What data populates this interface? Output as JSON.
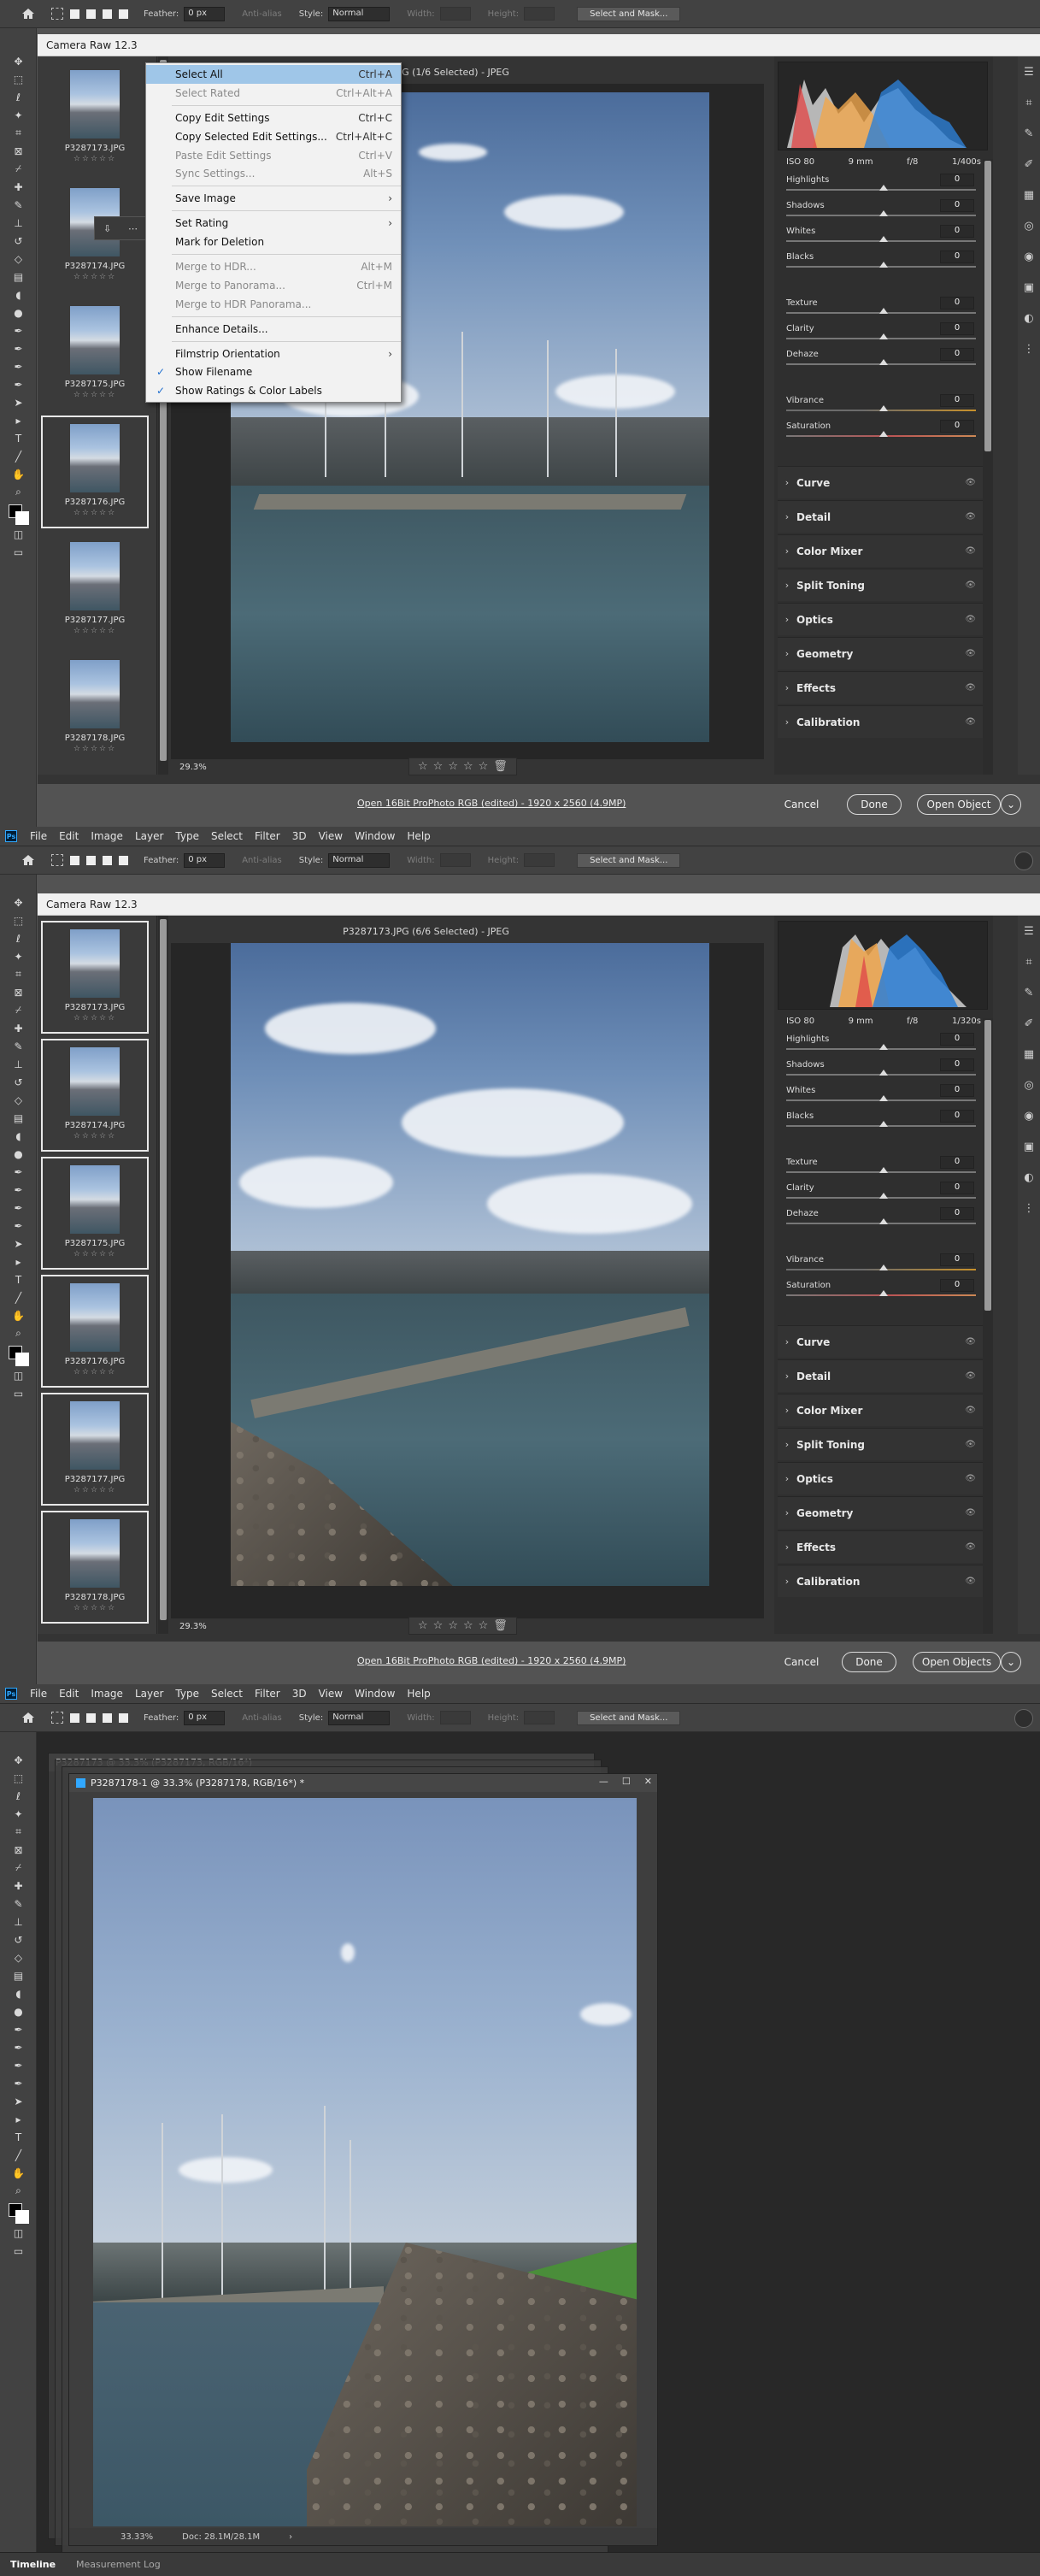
{
  "menubar": {
    "items": [
      "File",
      "Edit",
      "Image",
      "Layer",
      "Type",
      "Select",
      "Filter",
      "3D",
      "View",
      "Window",
      "Help"
    ]
  },
  "options": {
    "feather_label": "Feather:",
    "feather_value": "0 px",
    "antialias": "Anti-alias",
    "style_label": "Style:",
    "style_value": "Normal",
    "width_label": "Width:",
    "height_label": "Height:",
    "select_mask": "Select and Mask..."
  },
  "screen1": {
    "title": "Camera Raw 12.3",
    "file_caption": "P3287176.JPG (1/6 Selected)  -  JPEG",
    "zoom": "29.3%",
    "footer_link": "Open 16Bit ProPhoto RGB (edited)  -  1920 x 2560 (4.9MP)",
    "cancel": "Cancel",
    "done": "Done",
    "open": "Open Object",
    "meta": {
      "iso": "ISO 80",
      "focal": "9 mm",
      "aperture": "f/8",
      "shutter": "1/400s"
    }
  },
  "screen2": {
    "title": "Camera Raw 12.3",
    "file_caption": "P3287173.JPG (6/6 Selected)  -  JPEG",
    "zoom": "29.3%",
    "footer_link": "Open 16Bit ProPhoto RGB (edited)  -  1920 x 2560 (4.9MP)",
    "cancel": "Cancel",
    "done": "Done",
    "open": "Open Objects",
    "meta": {
      "iso": "ISO 80",
      "focal": "9 mm",
      "aperture": "f/8",
      "shutter": "1/320s"
    }
  },
  "thumbs": [
    {
      "name": "P3287173.JPG",
      "stars": "☆☆☆☆☆"
    },
    {
      "name": "P3287174.JPG",
      "stars": "☆☆☆☆☆"
    },
    {
      "name": "P3287175.JPG",
      "stars": "☆☆☆☆☆"
    },
    {
      "name": "P3287176.JPG",
      "stars": "☆☆☆☆☆"
    },
    {
      "name": "P3287177.JPG",
      "stars": "☆☆☆☆☆"
    },
    {
      "name": "P3287178.JPG",
      "stars": "☆☆☆☆☆"
    }
  ],
  "sliders": [
    {
      "name": "Highlights",
      "value": "0"
    },
    {
      "name": "Shadows",
      "value": "0"
    },
    {
      "name": "Whites",
      "value": "0"
    },
    {
      "name": "Blacks",
      "value": "0"
    },
    {
      "name": "Texture",
      "value": "0"
    },
    {
      "name": "Clarity",
      "value": "0"
    },
    {
      "name": "Dehaze",
      "value": "0"
    },
    {
      "name": "Vibrance",
      "value": "0"
    },
    {
      "name": "Saturation",
      "value": "0"
    }
  ],
  "sections": [
    "Curve",
    "Detail",
    "Color Mixer",
    "Split Toning",
    "Optics",
    "Geometry",
    "Effects",
    "Calibration"
  ],
  "context_menu": [
    {
      "label": "Select All",
      "shortcut": "Ctrl+A",
      "state": "highlight"
    },
    {
      "label": "Select Rated",
      "shortcut": "Ctrl+Alt+A",
      "state": "disabled"
    },
    {
      "sep": true
    },
    {
      "label": "Copy Edit Settings",
      "shortcut": "Ctrl+C",
      "state": "normal"
    },
    {
      "label": "Copy Selected Edit Settings...",
      "shortcut": "Ctrl+Alt+C",
      "state": "normal"
    },
    {
      "label": "Paste Edit Settings",
      "shortcut": "Ctrl+V",
      "state": "disabled"
    },
    {
      "label": "Sync Settings...",
      "shortcut": "Alt+S",
      "state": "disabled"
    },
    {
      "sep": true
    },
    {
      "label": "Save Image",
      "shortcut": "›",
      "state": "normal"
    },
    {
      "sep": true
    },
    {
      "label": "Set Rating",
      "shortcut": "›",
      "state": "normal"
    },
    {
      "label": "Mark for Deletion",
      "shortcut": "",
      "state": "normal"
    },
    {
      "sep": true
    },
    {
      "label": "Merge to HDR...",
      "shortcut": "Alt+M",
      "state": "disabled"
    },
    {
      "label": "Merge to Panorama...",
      "shortcut": "Ctrl+M",
      "state": "disabled"
    },
    {
      "label": "Merge to HDR Panorama...",
      "shortcut": "",
      "state": "disabled"
    },
    {
      "sep": true
    },
    {
      "label": "Enhance Details...",
      "shortcut": "",
      "state": "normal"
    },
    {
      "sep": true
    },
    {
      "label": "Filmstrip Orientation",
      "shortcut": "›",
      "state": "normal"
    },
    {
      "label": "Show Filename",
      "shortcut": "",
      "state": "checked"
    },
    {
      "label": "Show Ratings & Color Labels",
      "shortcut": "",
      "state": "checked"
    }
  ],
  "screen3": {
    "doc_title_back": "P3287173 @ 33.3% (P3287173, RGB/16*)",
    "doc_title": "P3287178-1 @ 33.3% (P3287178, RGB/16*) *",
    "zoom": "33.33%",
    "doc_info": "Doc: 28.1M/28.1M",
    "tabs": [
      "Timeline",
      "Measurement Log"
    ]
  },
  "icons": {
    "accent": "#31a8ff",
    "highlight": "#9fc6e8"
  }
}
